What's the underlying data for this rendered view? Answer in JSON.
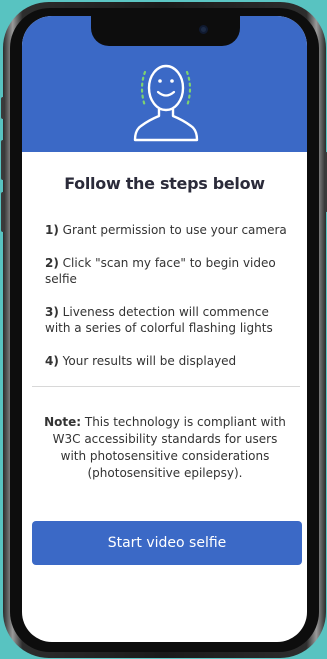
{
  "header": {
    "icon": "face-scan-icon",
    "accent_color": "#3b69c6"
  },
  "title": "Follow the steps below",
  "steps": [
    {
      "num": "1)",
      "text": "Grant permission to use your camera"
    },
    {
      "num": "2)",
      "text": "Click \"scan my face\" to begin video selfie"
    },
    {
      "num": "3)",
      "text": "Liveness detection will commence with a series of colorful flashing lights"
    },
    {
      "num": "4)",
      "text": "Your results will be displayed"
    }
  ],
  "note": {
    "label": "Note:",
    "text": "This technology is compliant with W3C accessibility standards for users with photosensitive considerations (photosensitive epilepsy)."
  },
  "button": {
    "label": "Start video selfie"
  }
}
